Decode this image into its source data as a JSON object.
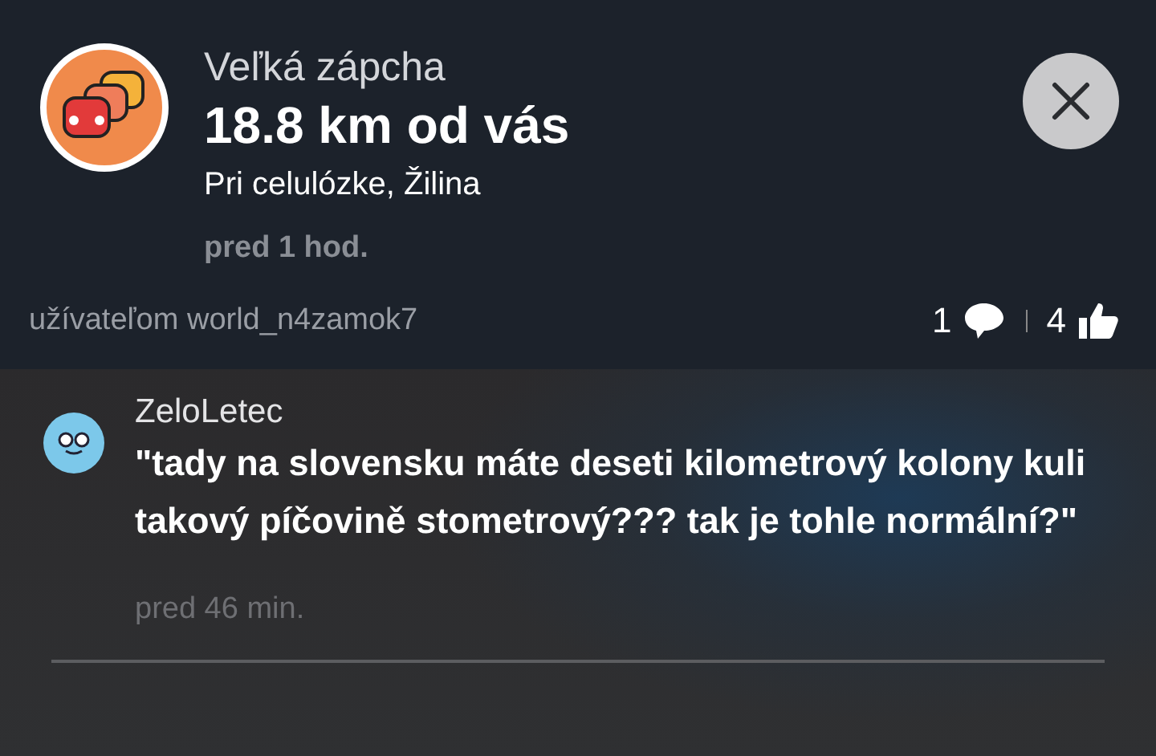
{
  "alert": {
    "type": "Veľká zápcha",
    "distance": "18.8 km od vás",
    "location": "Pri celulózke, Žilina",
    "time": "pred 1 hod.",
    "reporter": "užívateľom world_n4zamok7",
    "comments_count": "1",
    "likes_count": "4"
  },
  "comment": {
    "author": "ZeloLetec",
    "text": "\"tady na slovensku máte deseti kilometrový kolony kuli takový píčovině stometrový??? tak je tohle normální?\"",
    "time": "pred 46 min."
  }
}
